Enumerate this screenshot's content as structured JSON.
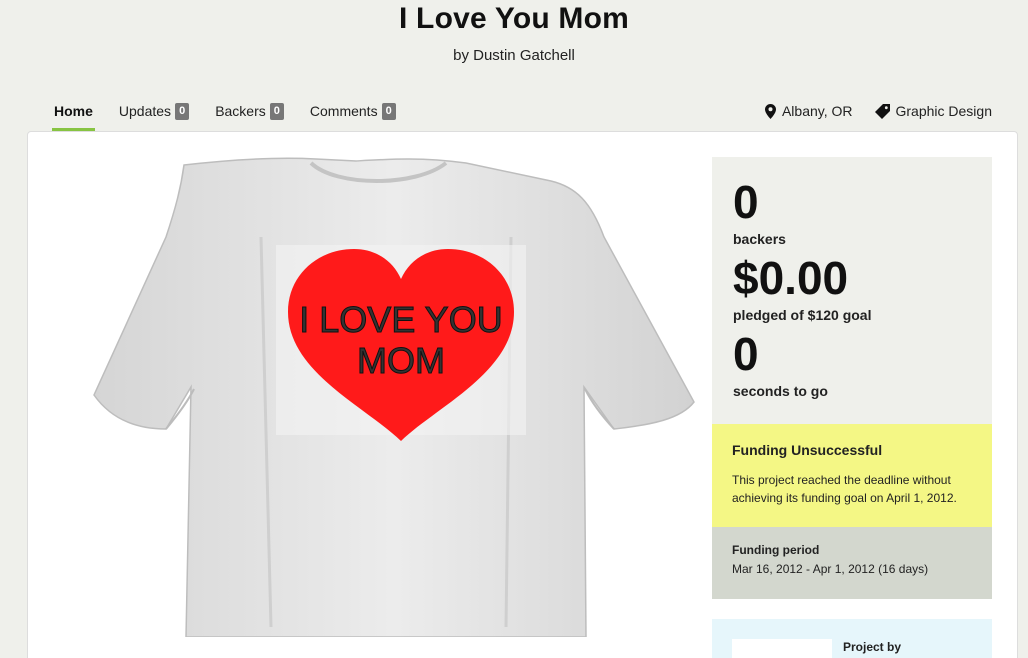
{
  "project": {
    "title": "I Love You Mom",
    "byline": "by Dustin Gatchell"
  },
  "tabs": [
    {
      "label": "Home",
      "count": null,
      "active": true
    },
    {
      "label": "Updates",
      "count": "0"
    },
    {
      "label": "Backers",
      "count": "0"
    },
    {
      "label": "Comments",
      "count": "0"
    }
  ],
  "meta": {
    "location": "Albany, OR",
    "location_icon": "map-pin-icon",
    "category": "Graphic Design",
    "category_icon": "tag-icon"
  },
  "media": {
    "shirt_line1": "I LOVE YOU",
    "shirt_line2": "MOM"
  },
  "stats": {
    "backers_value": "0",
    "backers_label": "backers",
    "pledged_value": "$0.00",
    "pledged_label": "pledged of $120 goal",
    "time_value": "0",
    "time_label": "seconds to go"
  },
  "notice": {
    "title": "Funding Unsuccessful",
    "text": "This project reached the deadline without achieving its funding goal on April 1, 2012."
  },
  "period": {
    "title": "Funding period",
    "text": "Mar 16, 2012 - Apr 1, 2012 (16 days)"
  },
  "creator": {
    "label": "Project by"
  },
  "colors": {
    "accent": "#87c442",
    "notice_bg": "#f4f785",
    "period_bg": "#d3d7ce",
    "stats_bg": "#eff0eb",
    "creator_bg": "#e6f6fb",
    "heart": "#ff1a1a"
  }
}
